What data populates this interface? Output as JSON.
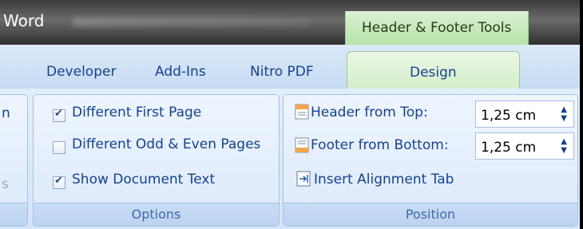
{
  "window": {
    "title": "Word",
    "context_tab": "Header & Footer Tools"
  },
  "tabs": [
    {
      "label": "Developer"
    },
    {
      "label": "Add-Ins"
    },
    {
      "label": "Nitro PDF"
    },
    {
      "label": "Design"
    }
  ],
  "left_group": {
    "cut_text_1": "n",
    "cut_text_2": "s"
  },
  "options": {
    "label": "Options",
    "items": [
      {
        "label": "Different First Page",
        "checked": true
      },
      {
        "label": "Different Odd & Even Pages",
        "checked": false
      },
      {
        "label": "Show Document Text",
        "checked": true
      }
    ]
  },
  "position": {
    "label": "Position",
    "header_label": "Header from Top:",
    "header_value": "1,25 cm",
    "footer_label": "Footer from Bottom:",
    "footer_value": "1,25 cm",
    "insert_tab": "Insert Alignment Tab"
  },
  "icons": {
    "header_position": "header-position-icon",
    "footer_position": "footer-position-icon",
    "alignment_tab": "alignment-tab-icon",
    "spinner_up": "spin-up-icon",
    "spinner_down": "spin-down-icon"
  }
}
